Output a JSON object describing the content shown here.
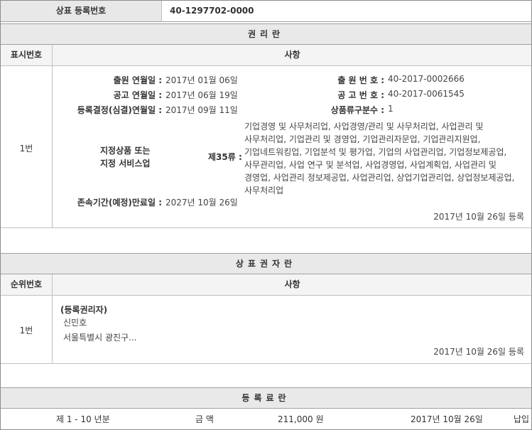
{
  "header": {
    "label": "상표 등록번호",
    "value": "40-1297702-0000"
  },
  "rights": {
    "section_title": "권리란",
    "col_number": "표시번호",
    "col_matter": "사항",
    "row_number": "1번",
    "app_date_label": "출원 연월일 :",
    "app_date": "2017년 01월 06일",
    "app_no_label": "출 원 번 호 :",
    "app_no": "40-2017-0002666",
    "pub_date_label": "공고 연월일 :",
    "pub_date": "2017년 06월 19일",
    "pub_no_label": "공 고 번 호 :",
    "pub_no": "40-2017-0061545",
    "reg_date_label": "등록결정(심결)연월일 :",
    "reg_date": "2017년 09월 11일",
    "class_count_label": "상품류구분수 :",
    "class_count": "1",
    "goods_label_line1": "지정상품 또는",
    "goods_label_line2": "지정 서비스업",
    "goods_class": "제35류 :",
    "goods_text": "기업경영 및 사무처리업, 사업경영/관리 및 사무처리업, 사업관리 및 사무처리업, 기업관리 및 경영업, 기업관리자문업, 기업관리지원업, 기업네트워킹업, 기업분석 및 평가업, 기업의 사업관리업, 기업정보제공업, 사무관리업, 사업 연구 및 분석업, 사업경영업, 사업계획업, 사업관리 및 경영업, 사업관리 정보제공업, 사업관리업, 상업기업관리업, 상업정보제공업, 사무처리업",
    "expiry_label": "존속기간(예정)만료일 :",
    "expiry": "2027년 10월 26일",
    "registered_note": "2017년 10월 26일 등록"
  },
  "owner": {
    "section_title": "상표권자란",
    "col_number": "순위번호",
    "col_matter": "사항",
    "row_number": "1번",
    "role": "(등록권리자)",
    "name": "신민호",
    "address": "서울특별시 광진구...",
    "registered_note": "2017년 10월 26일 등록"
  },
  "fee": {
    "section_title": "등록료란",
    "period": "제 1 - 10 년분",
    "amount_label": "금 액",
    "amount": "211,000 원",
    "date": "2017년 10월 26일",
    "status": "납입"
  }
}
